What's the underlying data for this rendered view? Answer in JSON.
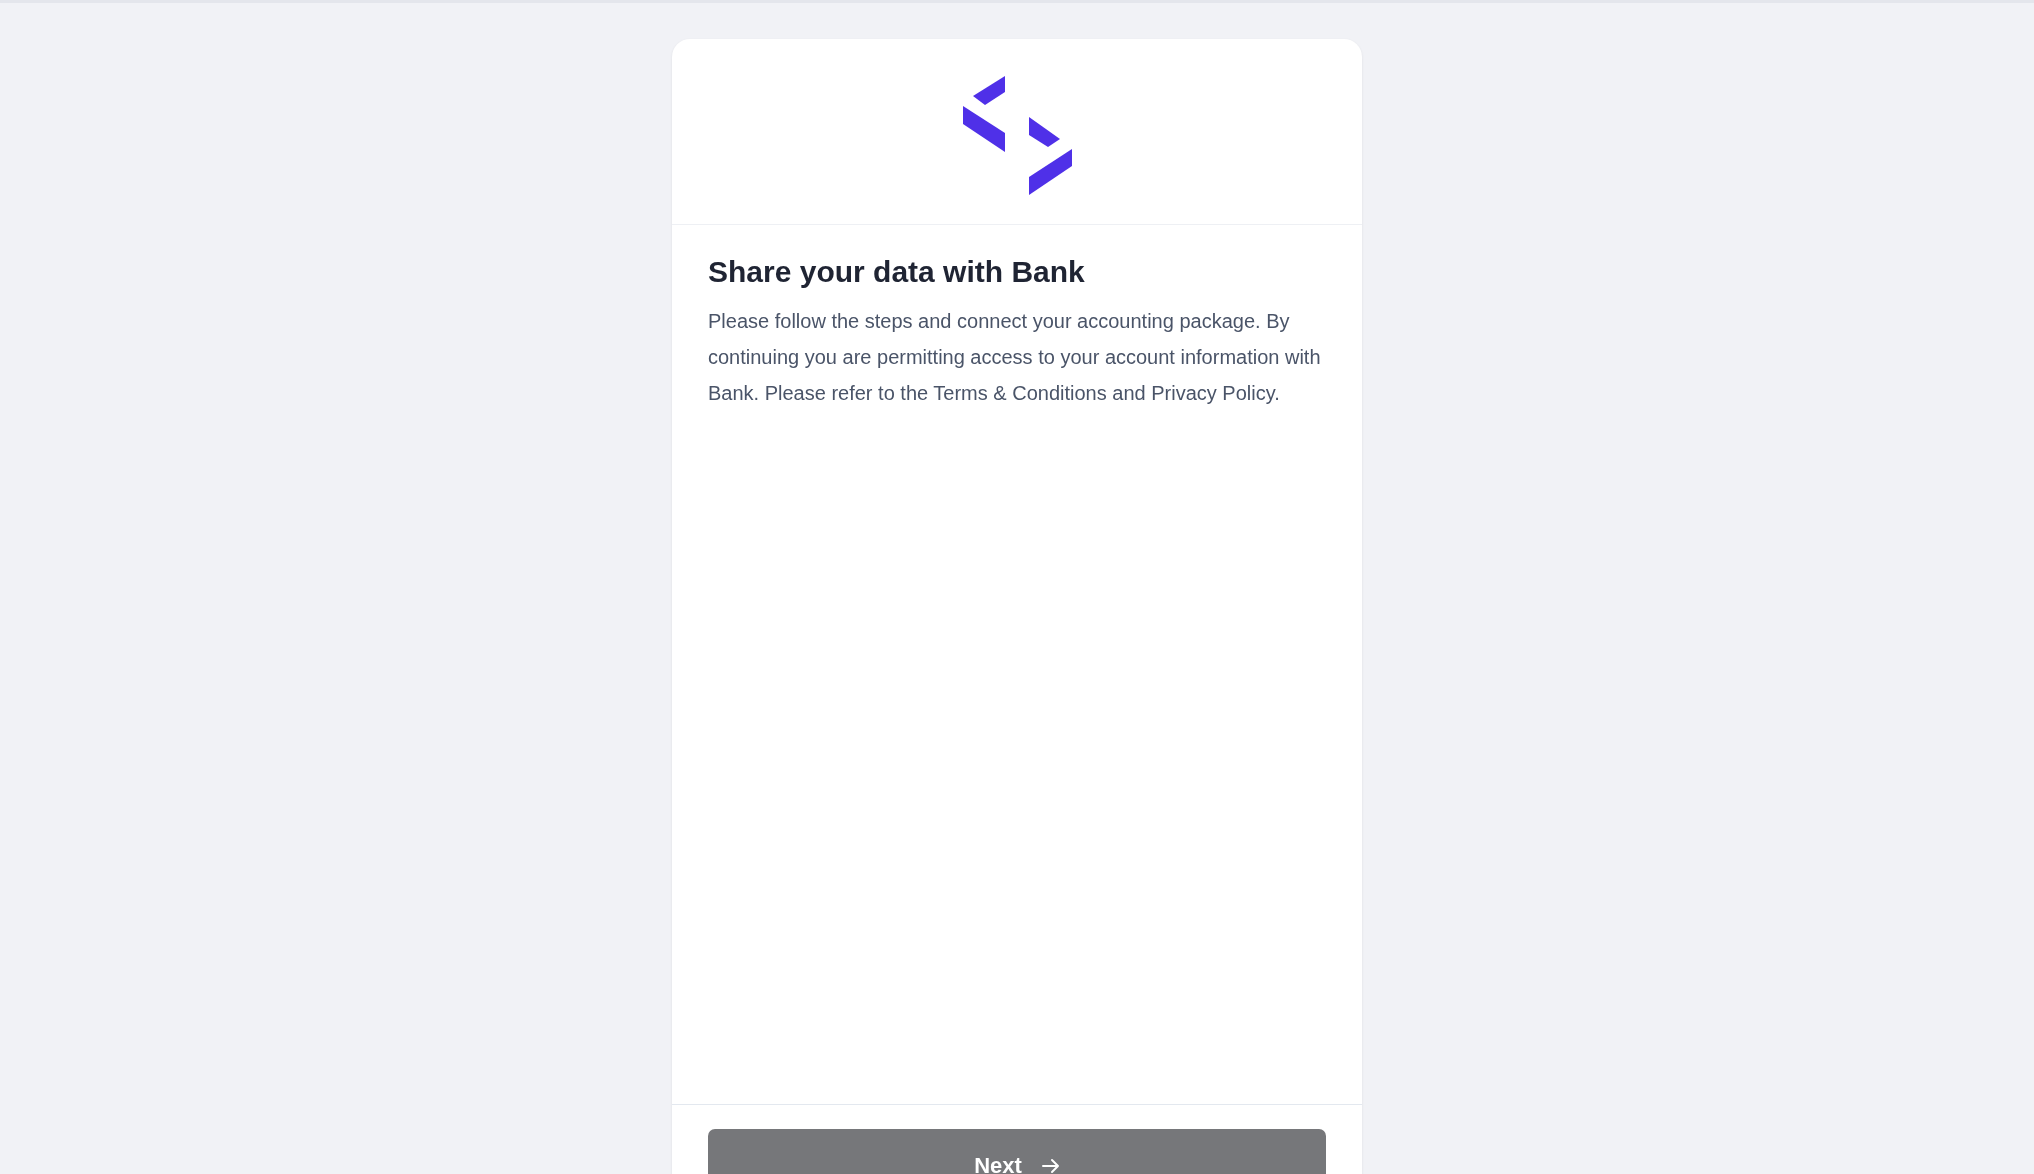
{
  "card": {
    "heading": "Share your data with Bank",
    "description": "Please follow the steps and connect your accounting package. By continuing you are permitting access to your account information with Bank. Please refer to the Terms & Conditions and Privacy Policy.",
    "next_button": {
      "label": "Next",
      "disabled": true
    }
  }
}
